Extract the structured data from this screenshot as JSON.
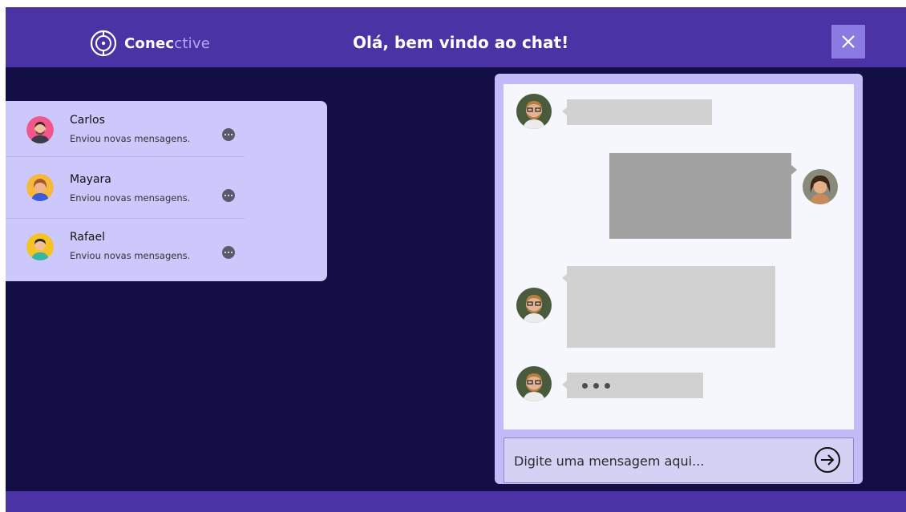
{
  "header": {
    "logo_text_main": "Conec",
    "logo_text_accent": "ctive",
    "title": "Olá, bem vindo ao chat!"
  },
  "contacts": [
    {
      "name": "Carlos",
      "status": "Enviou novas mensagens."
    },
    {
      "name": "Mayara",
      "status": "Enviou novas mensagens."
    },
    {
      "name": "Rafael",
      "status": "Enviou novas mensagens."
    }
  ],
  "chat": {
    "input_placeholder": "Digite uma mensagem aqui..."
  },
  "colors": {
    "header_bg": "#4a33a4",
    "page_bg": "#140e47",
    "panel_bg": "#cdc8fb",
    "chat_panel_bg": "#c3bbf8"
  },
  "icons": [
    "logo-icon",
    "close-icon",
    "more-icon",
    "send-icon"
  ]
}
